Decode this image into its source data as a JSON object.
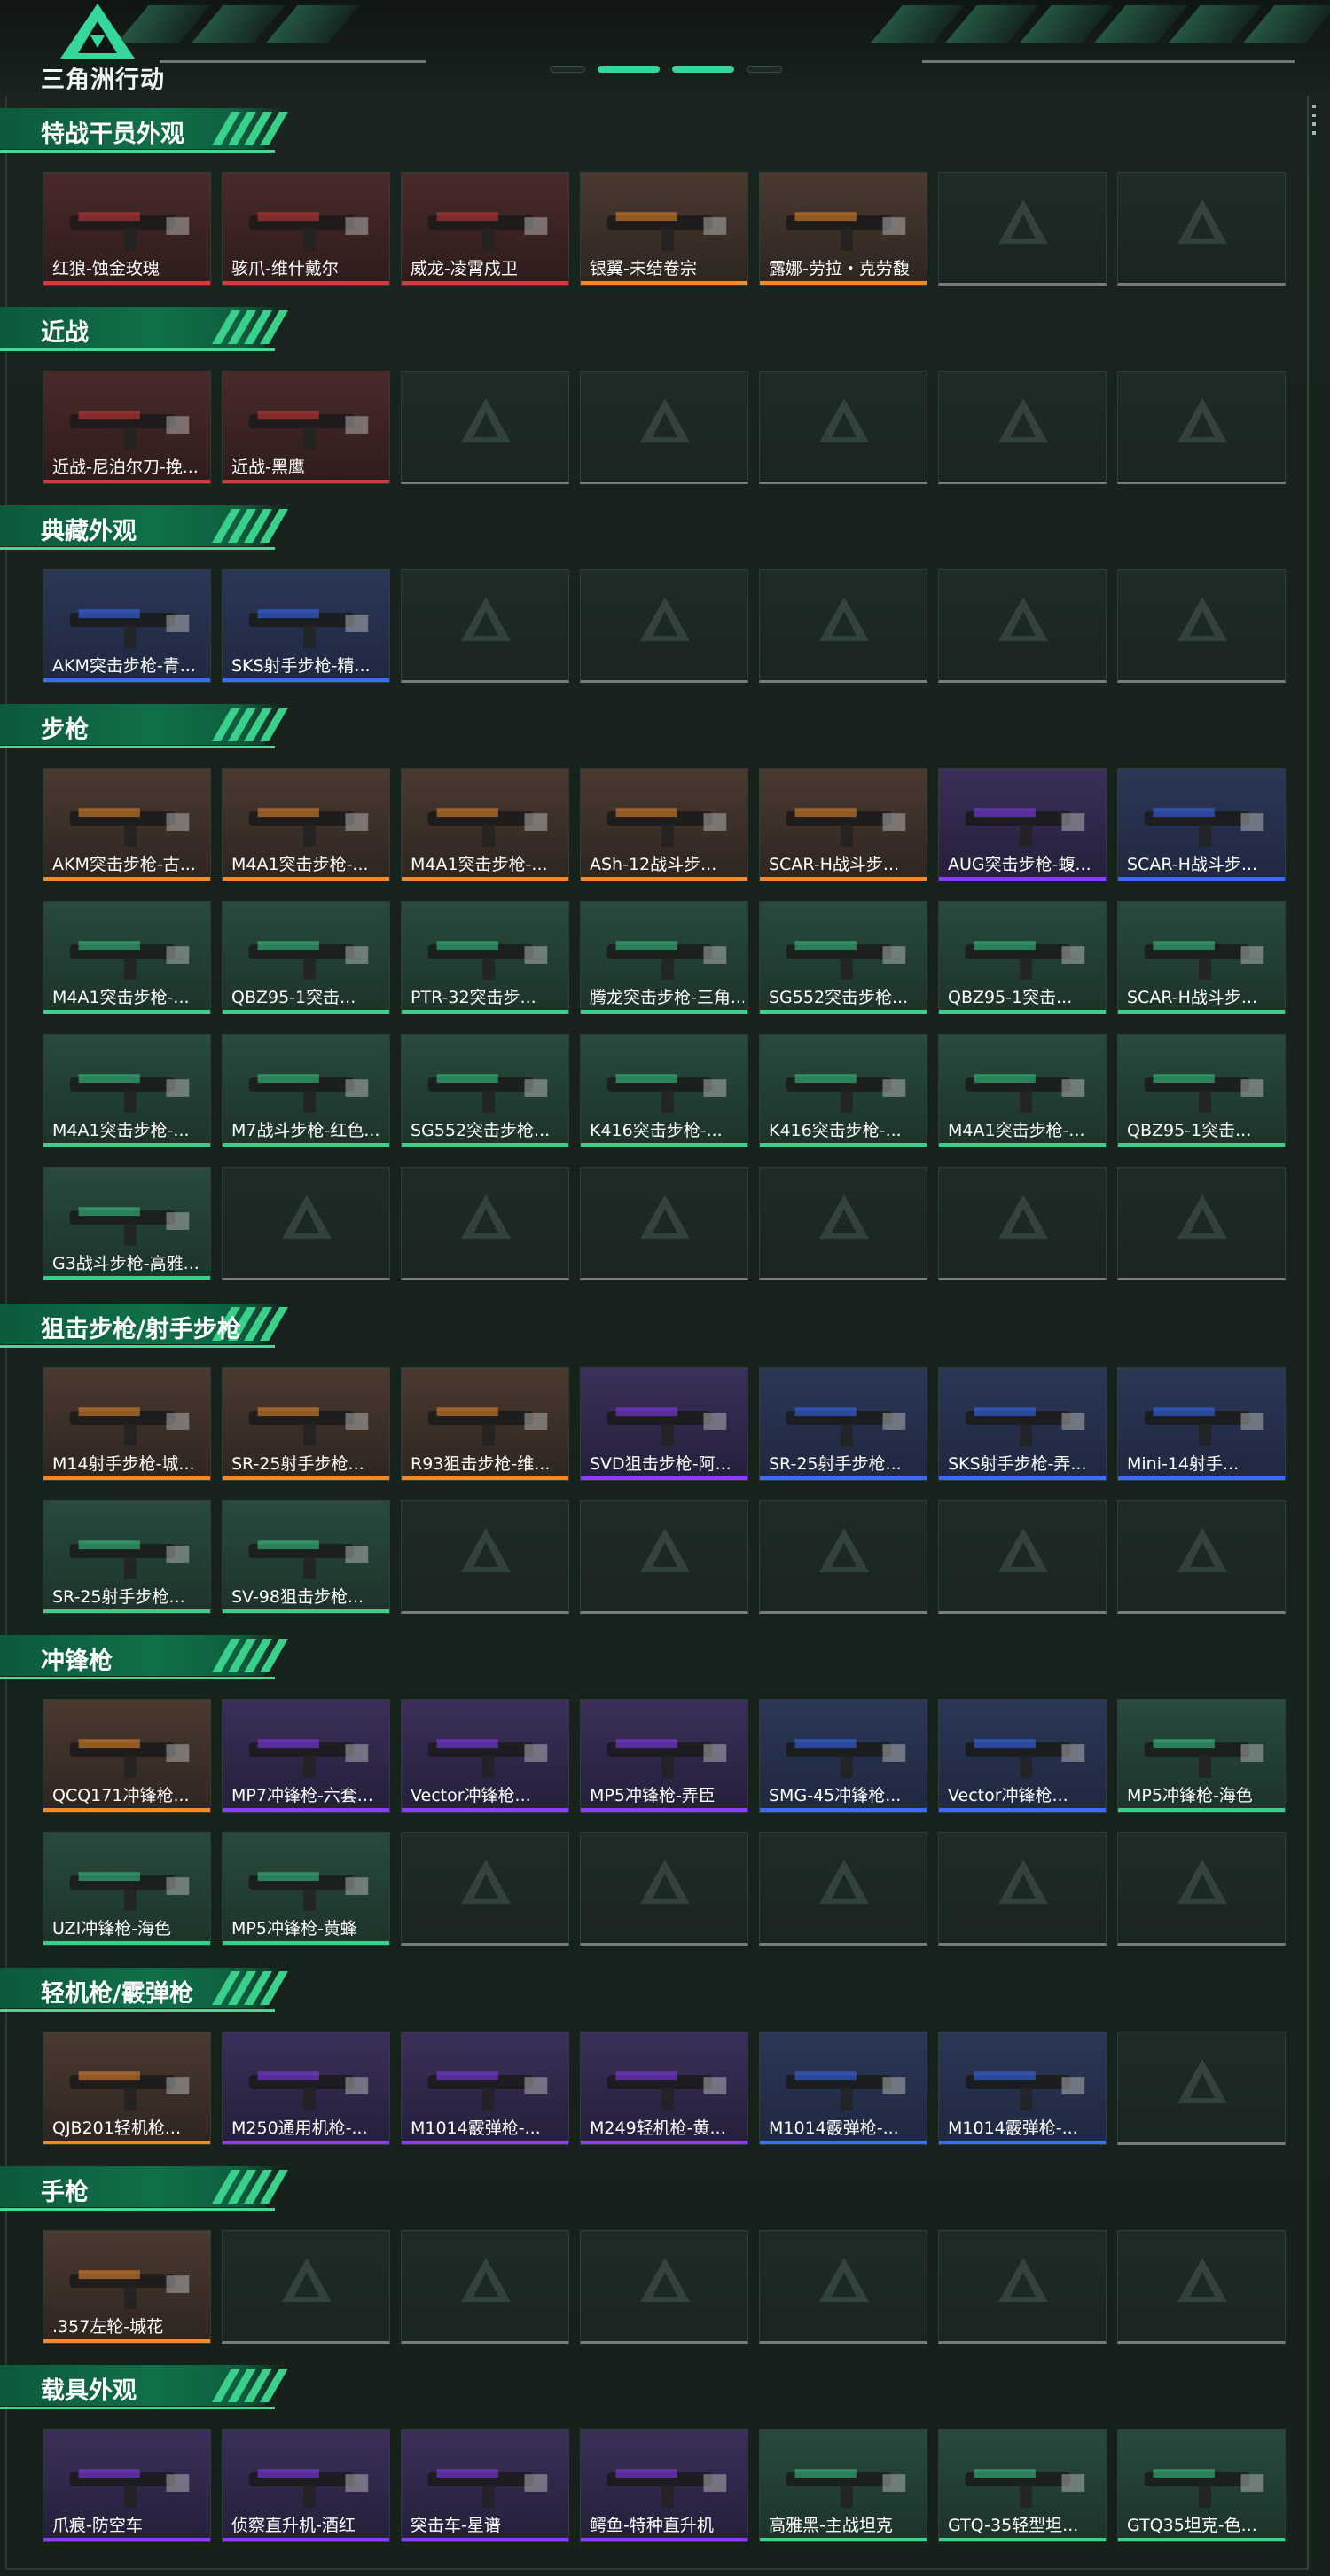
{
  "app": {
    "title": "三角洲行动"
  },
  "sections": [
    {
      "title": "特战干员外观",
      "cards": [
        {
          "label": "红狼-蚀金玫瑰",
          "rarity": "red"
        },
        {
          "label": "骇爪-维什戴尔",
          "rarity": "red"
        },
        {
          "label": "威龙-凌霄戍卫",
          "rarity": "red"
        },
        {
          "label": "银翼-未结卷宗",
          "rarity": "orange"
        },
        {
          "label": "露娜-劳拉・克劳馥",
          "rarity": "orange"
        },
        null,
        null
      ]
    },
    {
      "title": "近战",
      "cards": [
        {
          "label": "近战-尼泊尔刀-挽...",
          "rarity": "red"
        },
        {
          "label": "近战-黑鹰",
          "rarity": "red"
        },
        null,
        null,
        null,
        null,
        null
      ]
    },
    {
      "title": "典藏外观",
      "cards": [
        {
          "label": "AKM突击步枪-青...",
          "rarity": "blue"
        },
        {
          "label": "SKS射手步枪-精...",
          "rarity": "blue"
        },
        null,
        null,
        null,
        null,
        null
      ]
    },
    {
      "title": "步枪",
      "cards": [
        {
          "label": "AKM突击步枪-古...",
          "rarity": "orange"
        },
        {
          "label": "M4A1突击步枪-...",
          "rarity": "orange"
        },
        {
          "label": "M4A1突击步枪-...",
          "rarity": "orange"
        },
        {
          "label": "ASh-12战斗步...",
          "rarity": "orange"
        },
        {
          "label": "SCAR-H战斗步...",
          "rarity": "orange"
        },
        {
          "label": "AUG突击步枪-蝮...",
          "rarity": "purple"
        },
        {
          "label": "SCAR-H战斗步...",
          "rarity": "blue"
        },
        {
          "label": "M4A1突击步枪-...",
          "rarity": "green"
        },
        {
          "label": "QBZ95-1突击...",
          "rarity": "green"
        },
        {
          "label": "PTR-32突击步...",
          "rarity": "green"
        },
        {
          "label": "腾龙突击步枪-三角...",
          "rarity": "green"
        },
        {
          "label": "SG552突击步枪...",
          "rarity": "green"
        },
        {
          "label": "QBZ95-1突击...",
          "rarity": "green"
        },
        {
          "label": "SCAR-H战斗步...",
          "rarity": "green"
        },
        {
          "label": "M4A1突击步枪-...",
          "rarity": "green"
        },
        {
          "label": "M7战斗步枪-红色...",
          "rarity": "green"
        },
        {
          "label": "SG552突击步枪...",
          "rarity": "green"
        },
        {
          "label": "K416突击步枪-...",
          "rarity": "green"
        },
        {
          "label": "K416突击步枪-...",
          "rarity": "green"
        },
        {
          "label": "M4A1突击步枪-...",
          "rarity": "green"
        },
        {
          "label": "QBZ95-1突击...",
          "rarity": "green"
        },
        {
          "label": "G3战斗步枪-高雅...",
          "rarity": "green"
        },
        null,
        null,
        null,
        null,
        null,
        null
      ]
    },
    {
      "title": "狙击步枪/射手步枪",
      "cards": [
        {
          "label": "M14射手步枪-城...",
          "rarity": "orange"
        },
        {
          "label": "SR-25射手步枪...",
          "rarity": "orange"
        },
        {
          "label": "R93狙击步枪-维...",
          "rarity": "orange"
        },
        {
          "label": "SVD狙击步枪-阿...",
          "rarity": "purple"
        },
        {
          "label": "SR-25射手步枪...",
          "rarity": "blue"
        },
        {
          "label": "SKS射手步枪-弄...",
          "rarity": "blue"
        },
        {
          "label": "Mini-14射手...",
          "rarity": "blue"
        },
        {
          "label": "SR-25射手步枪...",
          "rarity": "green"
        },
        {
          "label": "SV-98狙击步枪...",
          "rarity": "green"
        },
        null,
        null,
        null,
        null,
        null
      ]
    },
    {
      "title": "冲锋枪",
      "cards": [
        {
          "label": "QCQ171冲锋枪...",
          "rarity": "orange"
        },
        {
          "label": "MP7冲锋枪-六套...",
          "rarity": "purple"
        },
        {
          "label": "Vector冲锋枪...",
          "rarity": "purple"
        },
        {
          "label": "MP5冲锋枪-弄臣",
          "rarity": "purple"
        },
        {
          "label": "SMG-45冲锋枪...",
          "rarity": "blue"
        },
        {
          "label": "Vector冲锋枪...",
          "rarity": "blue"
        },
        {
          "label": "MP5冲锋枪-海色",
          "rarity": "green"
        },
        {
          "label": "UZI冲锋枪-海色",
          "rarity": "green"
        },
        {
          "label": "MP5冲锋枪-黄蜂",
          "rarity": "green"
        },
        null,
        null,
        null,
        null,
        null
      ]
    },
    {
      "title": "轻机枪/霰弹枪",
      "cards": [
        {
          "label": "QJB201轻机枪...",
          "rarity": "orange"
        },
        {
          "label": "M250通用机枪-...",
          "rarity": "purple"
        },
        {
          "label": "M1014霰弹枪-...",
          "rarity": "purple"
        },
        {
          "label": "M249轻机枪-黄...",
          "rarity": "purple"
        },
        {
          "label": "M1014霰弹枪-...",
          "rarity": "blue"
        },
        {
          "label": "M1014霰弹枪-...",
          "rarity": "blue"
        },
        null
      ]
    },
    {
      "title": "手枪",
      "cards": [
        {
          "label": ".357左轮-城花",
          "rarity": "orange"
        },
        null,
        null,
        null,
        null,
        null,
        null
      ]
    },
    {
      "title": "载具外观",
      "cards": [
        {
          "label": "爪痕-防空车",
          "rarity": "purple"
        },
        {
          "label": "侦察直升机-酒红",
          "rarity": "purple"
        },
        {
          "label": "突击车-星谱",
          "rarity": "purple"
        },
        {
          "label": "鳄鱼-特种直升机",
          "rarity": "purple"
        },
        {
          "label": "高雅黑-主战坦克",
          "rarity": "green"
        },
        {
          "label": "GTQ-35轻型坦...",
          "rarity": "green"
        },
        {
          "label": "GTQ35坦克-色...",
          "rarity": "green"
        }
      ]
    }
  ],
  "colors": {
    "red": "#d43b3b",
    "orange": "#f08a2a",
    "purple": "#8b3cff",
    "blue": "#3a6cff",
    "green": "#3ad08a",
    "accent": "#35d89a"
  }
}
